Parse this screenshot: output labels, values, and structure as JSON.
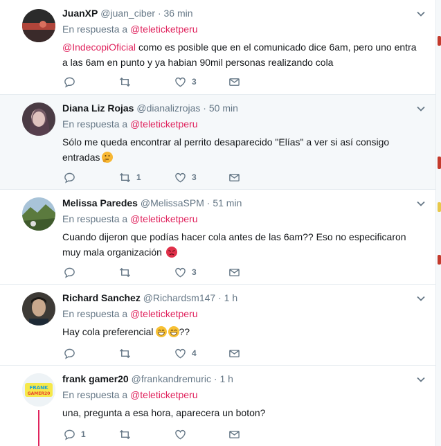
{
  "reply_prefix": "En respuesta a",
  "colors": {
    "mention": "#e0245e",
    "meta": "#657786",
    "text": "#14171a",
    "highlight_bg": "#f5f8fa",
    "divider": "#e6ecf0"
  },
  "icons": {
    "reply": "reply-icon",
    "retweet": "retweet-icon",
    "like": "heart-icon",
    "dm": "envelope-icon",
    "more": "chevron-down-icon"
  },
  "tweets": [
    {
      "name": "JuanXP",
      "handle": "@juan_ciber",
      "time": "36 min",
      "reply_to": "@teleticketperu",
      "mention": "@IndecopiOficial",
      "text": "como es posible que en el comunicado dice 6am, pero uno entra a las 6am en punto y ya habian 90mil personas realizando cola",
      "replies": "",
      "retweets": "",
      "likes": "3"
    },
    {
      "name": "Diana Liz Rojas",
      "handle": "@dianalizrojas",
      "time": "50 min",
      "reply_to": "@teleticketperu",
      "text": "Sólo me queda encontrar al perrito desaparecido \"Elías\" a ver si así consigo entradas",
      "emoji": "thinking-face",
      "replies": "",
      "retweets": "1",
      "likes": "3"
    },
    {
      "name": "Melissa Paredes",
      "handle": "@MelissaSPM",
      "time": "51 min",
      "reply_to": "@teleticketperu",
      "text": "Cuando dijeron que podías hacer cola antes de las 6am?? Eso no especificaron muy mala organización",
      "emoji": "angry-face",
      "replies": "",
      "retweets": "",
      "likes": "3"
    },
    {
      "name": "Richard Sanchez",
      "handle": "@Richardsm147",
      "time": "1 h",
      "reply_to": "@teleticketperu",
      "text": "Hay cola preferencial",
      "text_after": "??",
      "emoji": "grinning-face",
      "replies": "",
      "retweets": "",
      "likes": "4"
    },
    {
      "name": "frank gamer20",
      "handle": "@frankandremuric",
      "time": "1 h",
      "reply_to": "@teleticketperu",
      "text": "una, pregunta a esa hora, aparecera un boton?",
      "avatar_text": "FRANK GAMER20",
      "replies": "1",
      "retweets": "",
      "likes": ""
    }
  ]
}
